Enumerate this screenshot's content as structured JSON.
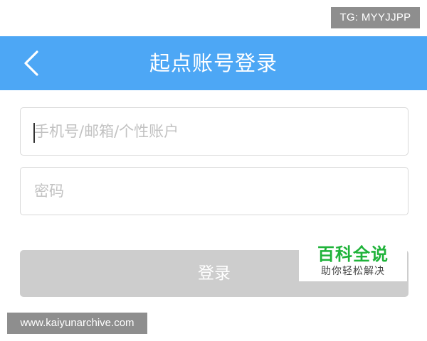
{
  "watermark_top": "TG: MYYJJPP",
  "header": {
    "title": "起点账号登录",
    "back_icon": "chevron-left-icon",
    "background_color": "#4da7f5"
  },
  "form": {
    "account_placeholder": "手机号/邮箱/个性账户",
    "account_value": "",
    "password_placeholder": "密码",
    "password_value": "",
    "login_label": "登录",
    "login_button_color": "#cdcdcd"
  },
  "baike_logo": {
    "title": "百科全说",
    "subtitle": "助你轻松解决",
    "title_color": "#1fb33a"
  },
  "watermark_bottom": "www.kaiyunarchive.com"
}
